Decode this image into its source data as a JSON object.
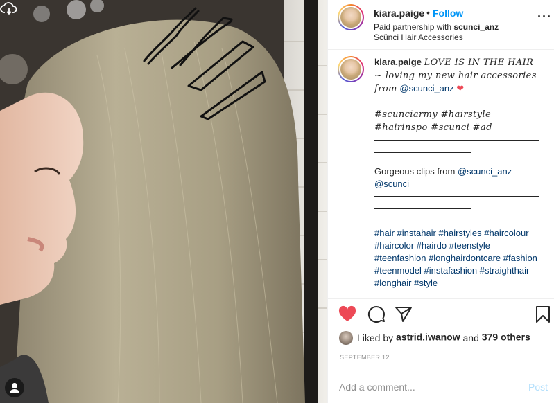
{
  "header": {
    "username": "kiara.paige",
    "dot": "•",
    "follow_label": "Follow",
    "paid_prefix": "Paid partnership with ",
    "paid_partner": "scunci_anz",
    "location": "Scünci Hair Accessories",
    "more_label": "···"
  },
  "caption": {
    "username": "kiara.paige",
    "line1_script": "LOVE IS IN THE HAIR ~ loving my new hair accessories from",
    "line1_mention": "@scunci_anz",
    "line1_emoji": "❤",
    "hashtags_script": "#scunciarmy #hairstyle #hairinspo #scunci #ad",
    "gorgeous_text": "Gorgeous clips from",
    "gorgeous_mention1": "@scunci_anz",
    "gorgeous_mention2": "@scunci",
    "hashtags": "#hair #instahair #hairstyles #haircolour #haircolor #hairdo #teenstyle #teenfashion #longhairdontcare #fashion #teenmodel #instafashion #straighthair #longhair #style"
  },
  "likes": {
    "prefix": "Liked by ",
    "liker": "astrid.iwanow",
    "middle": " and ",
    "others": "379 others"
  },
  "date": "SEPTEMBER 12",
  "comment": {
    "placeholder": "Add a comment...",
    "post_label": "Post"
  },
  "colors": {
    "link_blue": "#0095f6",
    "heart_red": "#ed4956",
    "post_disabled": "#b2dffc",
    "muted": "#8e8e8e"
  },
  "icons": [
    "cloud-download-icon",
    "more-options-icon",
    "heart-icon",
    "comment-icon",
    "share-icon",
    "bookmark-icon",
    "user-tag-icon"
  ]
}
